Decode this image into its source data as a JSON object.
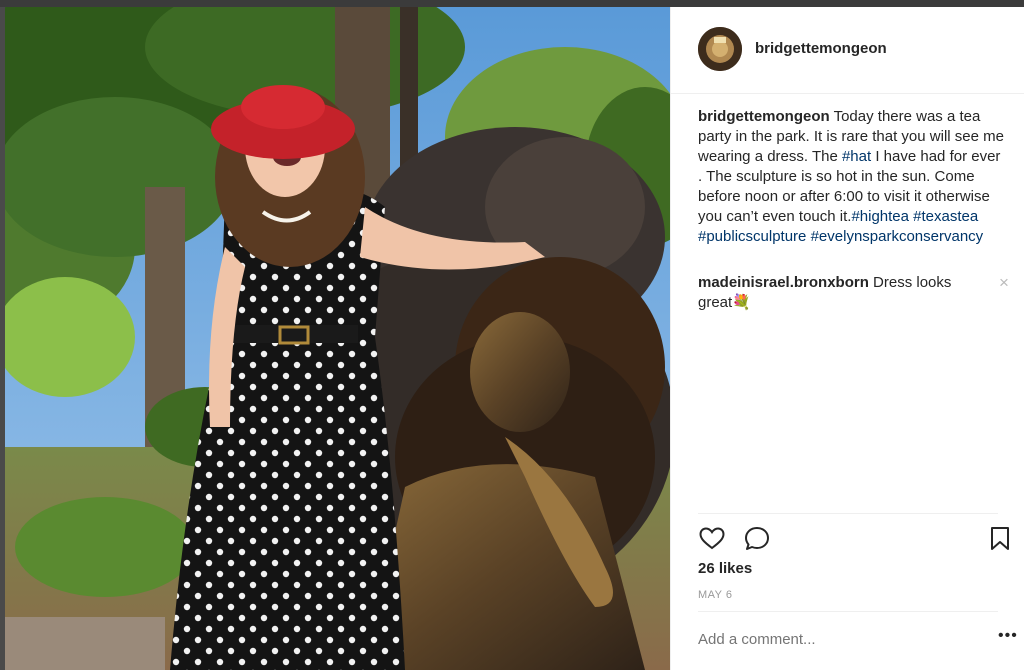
{
  "post": {
    "username": "bridgettemongeon",
    "caption_username": "bridgettemongeon",
    "caption_text": "Today there was a tea party in the park. It is rare that you will see me wearing a dress. The ",
    "caption_tag_hat": "#hat",
    "caption_text2": " I have had for ever . The sculpture is so hot in the sun. Come before noon or after 6:00 to visit it otherwise you can’t even touch it.",
    "caption_tag_1": "#hightea",
    "caption_tag_2": "#texastea",
    "caption_tag_3": "#publicsculpture",
    "caption_tag_4": "#evelynsparkconservancy",
    "comment_username": "madeinisrael.bronxborn",
    "comment_text": "Dress looks great💐",
    "comment_close": "×",
    "likes": "26 likes",
    "date": "MAY 6",
    "add_comment_placeholder": "Add a comment...",
    "more_options": "•••"
  },
  "icons": {
    "like": "heart-icon",
    "comment": "comment-icon",
    "save": "bookmark-icon"
  },
  "colors": {
    "hashtag": "#003569",
    "text": "#262626",
    "muted": "#999999"
  }
}
